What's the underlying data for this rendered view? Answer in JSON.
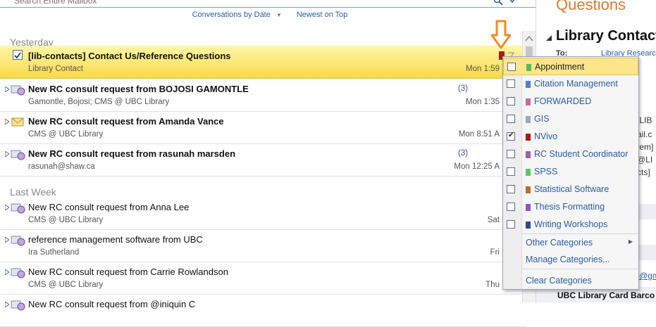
{
  "search": {
    "placeholder": "Search Entire Mailbox"
  },
  "sortbar": {
    "arrange_by": "Conversations by Date",
    "order": "Newest on Top"
  },
  "groups": [
    {
      "label": "Yesterday"
    },
    {
      "label": "Last Week"
    }
  ],
  "messages": [
    {
      "subject": "[lib-contacts] Contact Us/Reference Questions",
      "from": "Library Contact",
      "date": "Mon 1:59",
      "count": "",
      "bold": true,
      "selected": true
    },
    {
      "subject": "New RC consult request from BOJOSI GAMONTLE",
      "from": "Gamontle, Bojosi; CMS @ UBC Library",
      "date": "Mon 1:35",
      "count": "3",
      "bold": true
    },
    {
      "subject": "New RC consult request from Amanda Vance",
      "from": "CMS @ UBC Library",
      "date": "Mon 8:51 A",
      "count": "",
      "bold": true
    },
    {
      "subject": "New RC consult request from rasunah marsden",
      "from": "rasunah@shaw.ca",
      "date": "Mon 12:25 A",
      "count": "3",
      "bold": true
    },
    {
      "subject": "New RC consult request from Anna Lee",
      "from": "CMS @ UBC Library",
      "date": "Sat",
      "count": "",
      "bold": false
    },
    {
      "subject": "reference management software from UBC",
      "from": "Ira Sutherland",
      "date": "Fri",
      "count": "",
      "bold": false
    },
    {
      "subject": "New RC consult request from Carrie Rowlandson",
      "from": "CMS @ UBC Library",
      "date": "Thu",
      "count": "",
      "bold": false
    },
    {
      "subject": "New RC consult request from @iniquin C",
      "from": "",
      "date": "",
      "count": "",
      "bold": false
    }
  ],
  "reading_pane": {
    "title": "Questions",
    "conversation": "Library Contact",
    "to_label": "To:",
    "to_value": "Library Research",
    "fragments": [
      "[LIB",
      "ail.c",
      "tem]",
      "@LI",
      "cts]"
    ],
    "link_fragment": "@gm",
    "card_text": "UBC Library Card Barco"
  },
  "category_menu": {
    "items": [
      {
        "label": "Appointment",
        "color": "#5cb85c",
        "checked": false,
        "highlighted": true
      },
      {
        "label": "Citation Management",
        "color": "#4f7fd0",
        "checked": false
      },
      {
        "label": "FORWARDED",
        "color": "#c2719a",
        "checked": false
      },
      {
        "label": "GIS",
        "color": "#9aa8c6",
        "checked": false
      },
      {
        "label": "NVivo",
        "color": "#b01818",
        "checked": true
      },
      {
        "label": "RC Student Coordinator",
        "color": "#a45da3",
        "checked": false
      },
      {
        "label": "SPSS",
        "color": "#62c462",
        "checked": false
      },
      {
        "label": "Statistical Software",
        "color": "#c46a2a",
        "checked": false
      },
      {
        "label": "Thesis Formatting",
        "color": "#8e54c8",
        "checked": false
      },
      {
        "label": "Writing Workshops",
        "color": "#2b4a8c",
        "checked": false
      }
    ],
    "other": "Other Categories",
    "manage": "Manage Categories...",
    "clear": "Clear Categories"
  }
}
